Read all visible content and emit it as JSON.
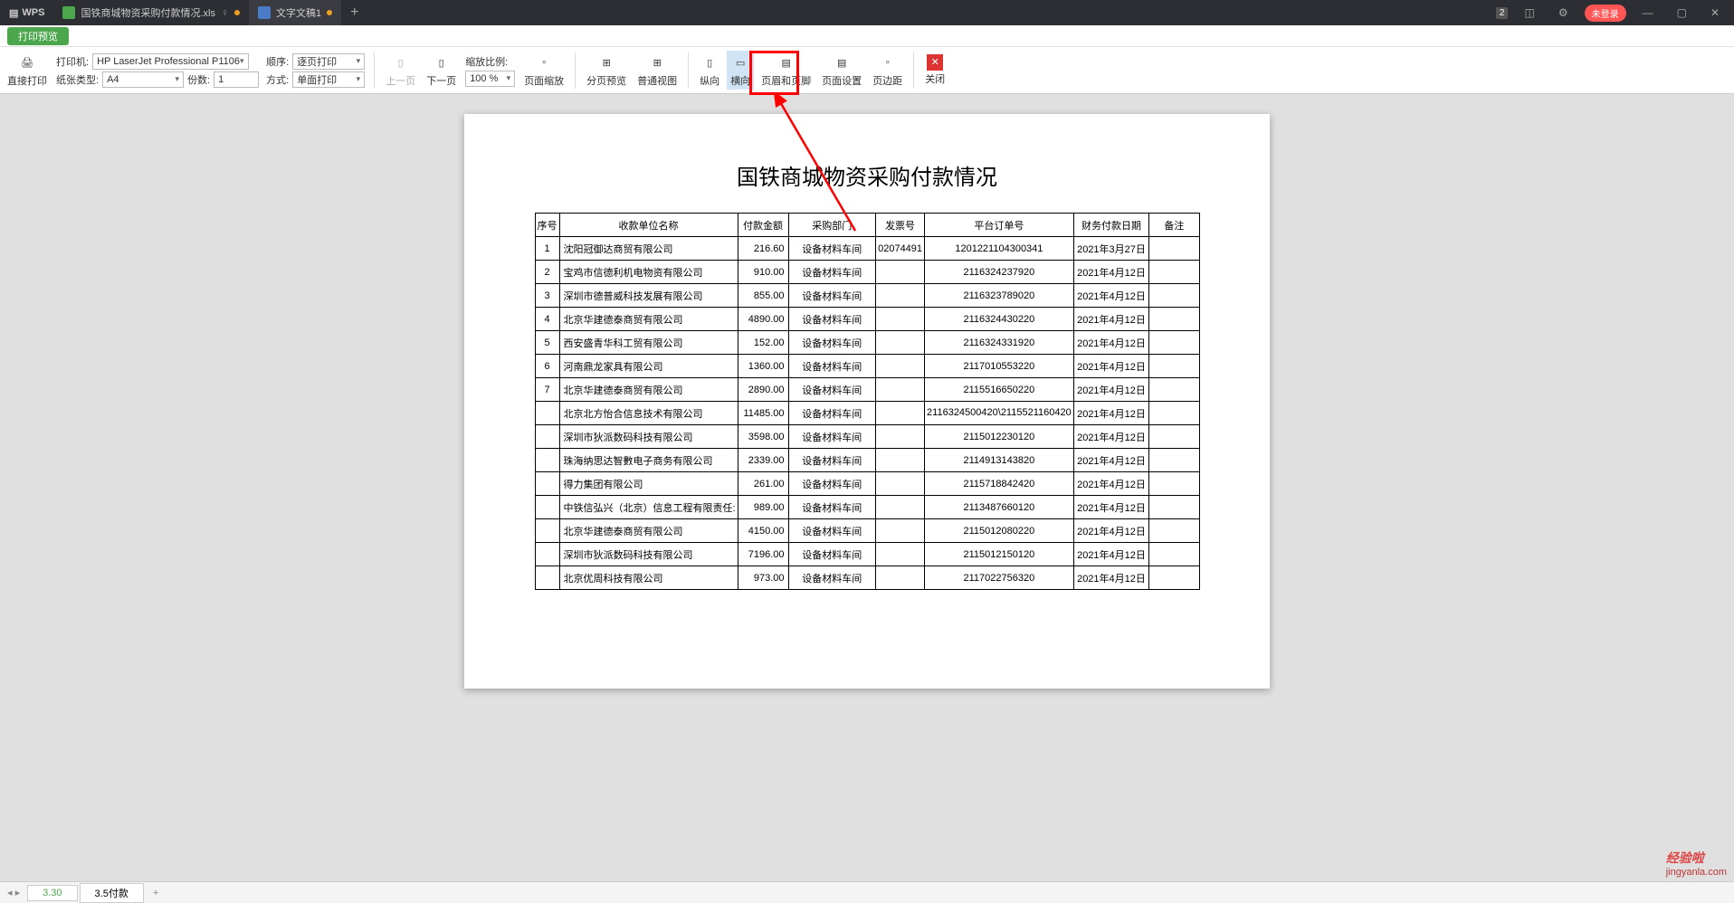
{
  "titlebar": {
    "app": "WPS",
    "tab1": "国铁商城物资采购付款情况.xls",
    "tab2": "文字文稿1",
    "badge": "2",
    "login": "未登录"
  },
  "mode": {
    "label": "打印预览"
  },
  "ribbon": {
    "direct_print": "直接打印",
    "printer_lbl": "打印机:",
    "printer_val": "HP LaserJet Professional P1106",
    "paper_lbl": "纸张类型:",
    "paper_val": "A4",
    "copies_lbl": "份数:",
    "copies_val": "1",
    "order_lbl": "顺序:",
    "order_val": "逐页打印",
    "mode_lbl": "方式:",
    "mode_val": "单面打印",
    "prev": "上一页",
    "next": "下一页",
    "zoom_lbl": "缩放比例:",
    "zoom_val": "100 %",
    "scale": "页面缩放",
    "paginate": "分页预览",
    "normal": "普通视图",
    "portrait": "纵向",
    "landscape": "横向",
    "header": "页眉和页脚",
    "pagesetup": "页面设置",
    "margins": "页边距",
    "close": "关闭"
  },
  "doc": {
    "title": "国铁商城物资采购付款情况",
    "cols": [
      "序号",
      "收款单位名称",
      "付款金额",
      "采购部门",
      "发票号",
      "平台订单号",
      "财务付款日期",
      "备注"
    ],
    "rows": [
      [
        "1",
        "沈阳冠御达商贸有限公司",
        "216.60",
        "设备材料车间",
        "02074491",
        "1201221104300341",
        "2021年3月27日",
        ""
      ],
      [
        "2",
        "宝鸡市信德利机电物资有限公司",
        "910.00",
        "设备材料车间",
        "",
        "2116324237920",
        "2021年4月12日",
        ""
      ],
      [
        "3",
        "深圳市德普威科技发展有限公司",
        "855.00",
        "设备材料车间",
        "",
        "2116323789020",
        "2021年4月12日",
        ""
      ],
      [
        "4",
        "北京华建德泰商贸有限公司",
        "4890.00",
        "设备材料车间",
        "",
        "2116324430220",
        "2021年4月12日",
        ""
      ],
      [
        "5",
        "西安盛青华科工贸有限公司",
        "152.00",
        "设备材料车间",
        "",
        "2116324331920",
        "2021年4月12日",
        ""
      ],
      [
        "6",
        "河南鼎龙家具有限公司",
        "1360.00",
        "设备材料车间",
        "",
        "2117010553220",
        "2021年4月12日",
        ""
      ],
      [
        "7",
        "北京华建德泰商贸有限公司",
        "2890.00",
        "设备材料车间",
        "",
        "2115516650220",
        "2021年4月12日",
        ""
      ],
      [
        "",
        "北京北方怡合信息技术有限公司",
        "11485.00",
        "设备材料车间",
        "",
        "2116324500420\\2115521160420",
        "2021年4月12日",
        ""
      ],
      [
        "",
        "深圳市狄派数码科技有限公司",
        "3598.00",
        "设备材料车间",
        "",
        "2115012230120",
        "2021年4月12日",
        ""
      ],
      [
        "",
        "珠海纳思达智數电子商务有限公司",
        "2339.00",
        "设备材料车间",
        "",
        "2114913143820",
        "2021年4月12日",
        ""
      ],
      [
        "",
        "得力集团有限公司",
        "261.00",
        "设备材料车间",
        "",
        "2115718842420",
        "2021年4月12日",
        ""
      ],
      [
        "",
        "中铁信弘兴（北京）信息工程有限责任:",
        "989.00",
        "设备材料车间",
        "",
        "2113487660120",
        "2021年4月12日",
        ""
      ],
      [
        "",
        "北京华建德泰商贸有限公司",
        "4150.00",
        "设备材料车间",
        "",
        "2115012080220",
        "2021年4月12日",
        ""
      ],
      [
        "",
        "深圳市狄派数码科技有限公司",
        "7196.00",
        "设备材料车间",
        "",
        "2115012150120",
        "2021年4月12日",
        ""
      ],
      [
        "",
        "北京优周科技有限公司",
        "973.00",
        "设备材料车间",
        "",
        "2117022756320",
        "2021年4月12日",
        ""
      ]
    ]
  },
  "status": {
    "sheet1": "3.30",
    "sheet2": "3.5付款",
    "add": "+"
  },
  "watermark": {
    "t1": "经验啦",
    "t2": "jingyanla.com"
  }
}
